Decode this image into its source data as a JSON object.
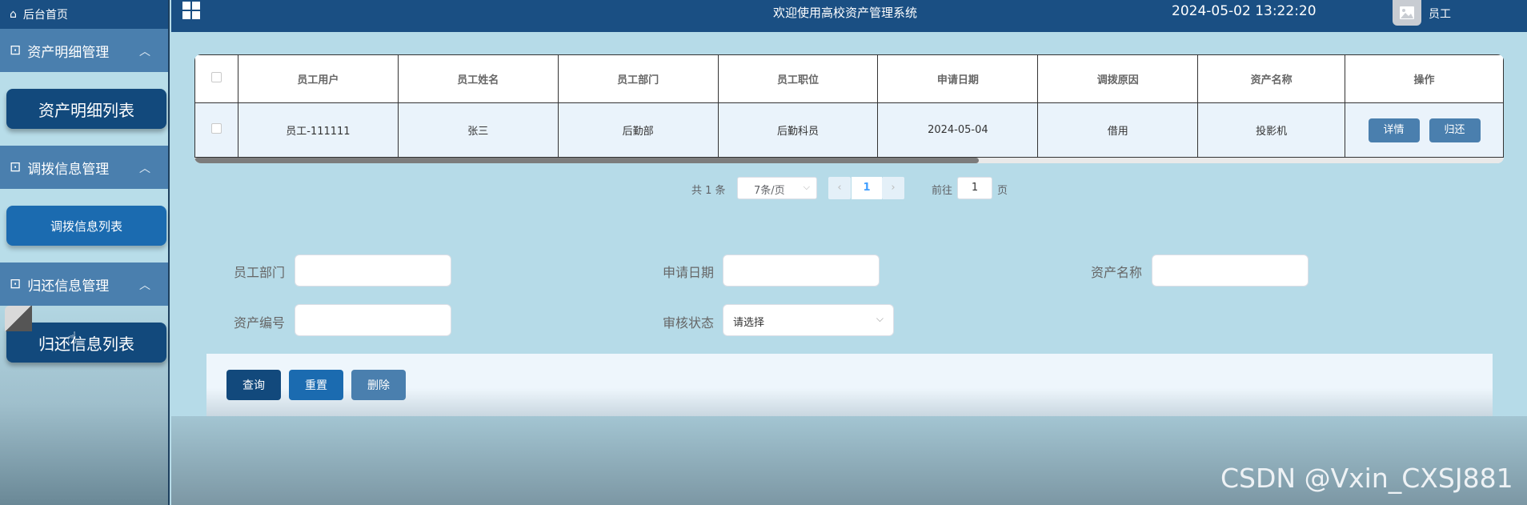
{
  "sidebar": {
    "home": "后台首页",
    "groups": [
      {
        "title": "资产明细管理",
        "item": "资产明细列表"
      },
      {
        "title": "调拨信息管理",
        "item": "调拨信息列表"
      },
      {
        "title": "归还信息管理",
        "item": "归还信息列表"
      }
    ]
  },
  "topbar": {
    "welcome": "欢迎使用高校资产管理系统",
    "datetime": "2024-05-02 13:22:20",
    "user": "员工"
  },
  "table": {
    "headers": [
      "员工用户",
      "员工姓名",
      "员工部门",
      "员工职位",
      "申请日期",
      "调拨原因",
      "资产名称",
      "操作"
    ],
    "rows": [
      {
        "cells": [
          "员工-111111",
          "张三",
          "后勤部",
          "后勤科员",
          "2024-05-04",
          "借用",
          "投影机"
        ],
        "actions": [
          "详情",
          "归还"
        ]
      }
    ]
  },
  "pagination": {
    "total": "共 1 条",
    "page_size": "7条/页",
    "current": "1",
    "goto_label": "前往",
    "goto_value": "1",
    "page_suffix": "页"
  },
  "search_form": {
    "dept_label": "员工部门",
    "date_label": "申请日期",
    "asset_name_label": "资产名称",
    "asset_no_label": "资产编号",
    "status_label": "审核状态",
    "status_placeholder": "请选择"
  },
  "actions": {
    "query": "查询",
    "reset": "重置",
    "delete": "删除"
  },
  "watermark": "CSDN @Vxin_CXSJ881",
  "colors": {
    "primary": "#12497c",
    "accent": "#1b6bb0",
    "muted": "#4a7fae",
    "background": "#b6dbe8"
  }
}
